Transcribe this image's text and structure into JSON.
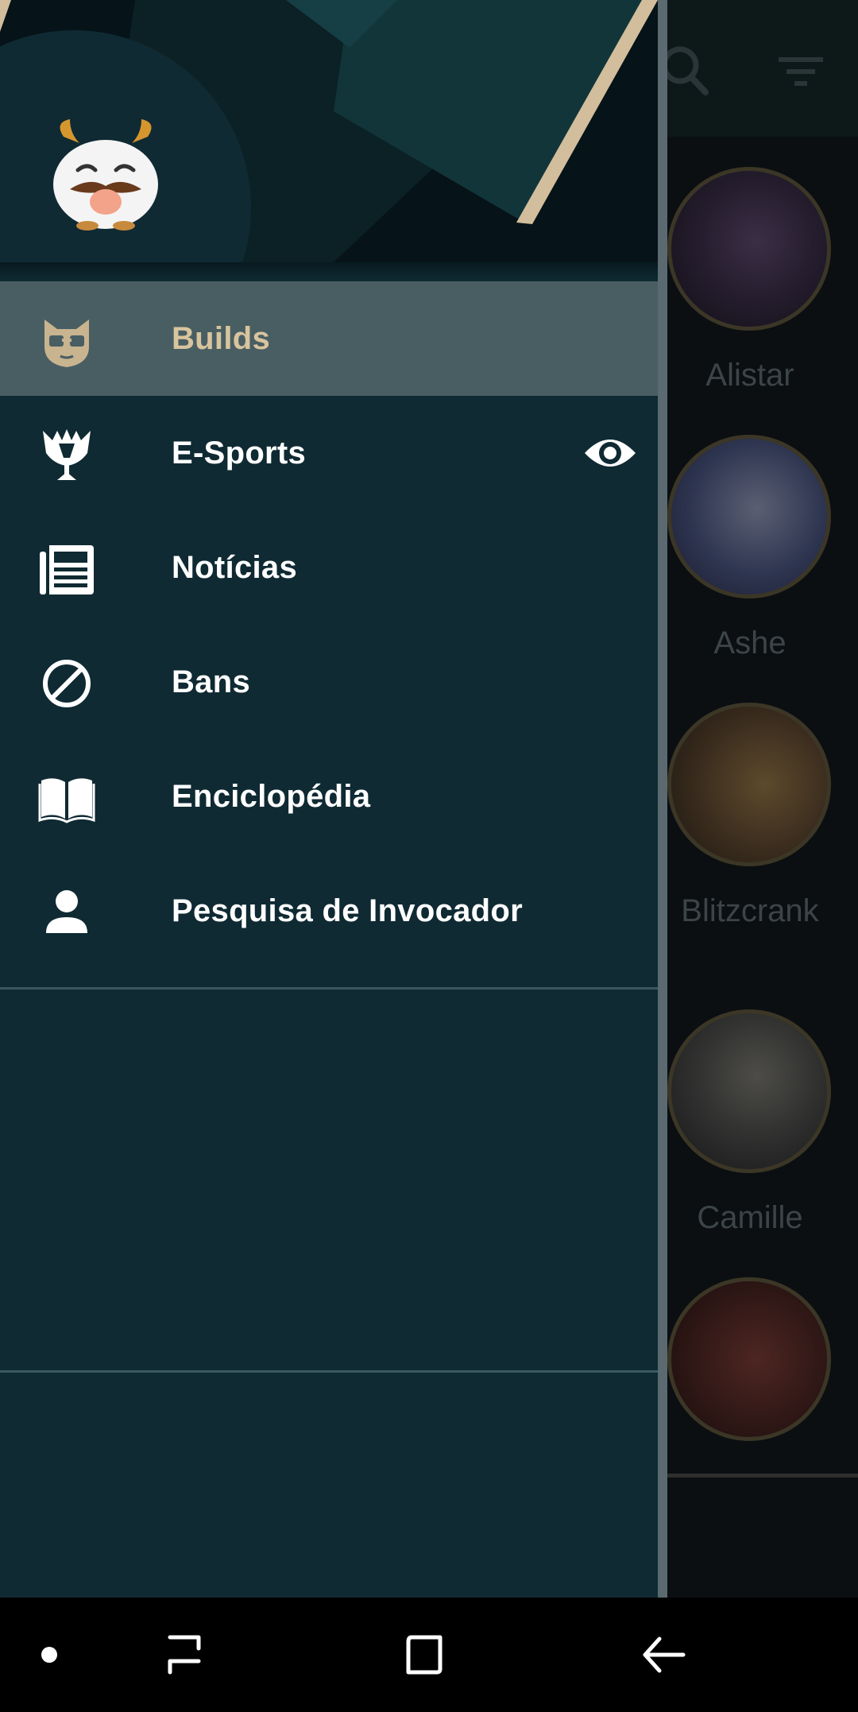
{
  "app_bar": {
    "search_icon": "search-icon",
    "filter_icon": "filter-icon"
  },
  "champions": [
    {
      "name": "Alistar"
    },
    {
      "name": "Ashe"
    },
    {
      "name": "Blitzcrank"
    },
    {
      "name": "Camille"
    },
    {
      "name": ""
    }
  ],
  "drawer": {
    "avatar": "poro-avatar",
    "menu": [
      {
        "label": "Builds",
        "icon": "cat-mask-icon",
        "active": true
      },
      {
        "label": "E-Sports",
        "icon": "worlds-trophy-icon",
        "badge_icon": "eye-icon"
      },
      {
        "label": "Notícias",
        "icon": "newspaper-icon"
      },
      {
        "label": "Bans",
        "icon": "ban-icon"
      },
      {
        "label": "Enciclopédia",
        "icon": "book-icon"
      },
      {
        "label": "Pesquisa de Invocador",
        "icon": "person-icon"
      }
    ]
  },
  "colors": {
    "drawer_bg": "#0f2a33",
    "active_bg": "#495e63",
    "active_label": "#d8c49d",
    "accent_gold": "#c8b48f"
  },
  "system_nav": {
    "dot": "dot-icon",
    "recents": "recents-icon",
    "home": "home-icon",
    "back": "back-icon"
  }
}
